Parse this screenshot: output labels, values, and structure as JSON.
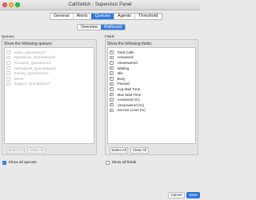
{
  "window": {
    "title": "CallSwitch - Supervisor Panel"
  },
  "tabs": [
    {
      "label": "General",
      "active": false
    },
    {
      "label": "Alerts",
      "active": false
    },
    {
      "label": "Queues",
      "active": true
    },
    {
      "label": "Agents",
      "active": false
    },
    {
      "label": "Threshold",
      "active": false
    }
  ],
  "subtabs": [
    {
      "label": "Overview",
      "active": false
    },
    {
      "label": "Wallboard",
      "active": true
    }
  ],
  "queues": {
    "section_label": "Queues",
    "panel_title": "Show the following queues:",
    "items": [
      {
        "label": "Sales_QueueNov17",
        "checked": false,
        "enabled": false
      },
      {
        "label": "Operations_QueueMay18",
        "checked": false,
        "enabled": false
      },
      {
        "label": "Accounts_QueueNov17",
        "checked": false,
        "enabled": false
      },
      {
        "label": "NetSupport_QueueMay18",
        "checked": false,
        "enabled": false
      },
      {
        "label": "Porting_QueueNov17",
        "checked": false,
        "enabled": false
      },
      {
        "label": "Demo",
        "checked": false,
        "enabled": false
      },
      {
        "label": "Support_QueueNov17",
        "checked": false,
        "enabled": false
      }
    ],
    "select_all_label": "Select All",
    "clear_all_label": "Clear All",
    "show_all_label": "Show all queues",
    "show_all_checked": true
  },
  "fields": {
    "section_label": "Fields",
    "panel_title": "Show the following fields:",
    "items": [
      {
        "label": "Total Calls",
        "checked": true
      },
      {
        "label": "Answered",
        "checked": true
      },
      {
        "label": "Unanswered",
        "checked": true
      },
      {
        "label": "Waiting",
        "checked": true
      },
      {
        "label": "Idle",
        "checked": true
      },
      {
        "label": "Busy",
        "checked": true
      },
      {
        "label": "Paused",
        "checked": true
      },
      {
        "label": "Avg Wait Time",
        "checked": true
      },
      {
        "label": "Max Wait Time",
        "checked": true
      },
      {
        "label": "Answered (%)",
        "checked": true
      },
      {
        "label": "Unanswered (%)",
        "checked": true
      },
      {
        "label": "Service Level (%)",
        "checked": true
      }
    ],
    "select_all_label": "Select All",
    "clear_all_label": "Clear All",
    "show_all_label": "Show all fields",
    "show_all_checked": false
  },
  "footer": {
    "cancel_label": "Cancel",
    "save_label": "Save"
  },
  "colors": {
    "accent": "#2f7ae5",
    "close": "#ff5f57",
    "minimize": "#febc2e",
    "zoom": "#28c840"
  },
  "icons": {
    "check": "✓"
  }
}
